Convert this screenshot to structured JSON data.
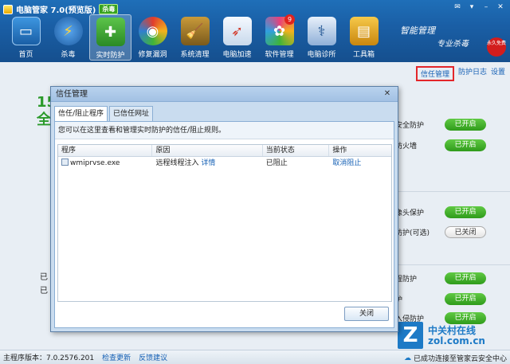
{
  "window": {
    "title": "电脑管家 7.0(预览版)",
    "badge": "杀毒",
    "controls": [
      "✉",
      "▾",
      "–",
      "✕"
    ]
  },
  "toolbar": {
    "items": [
      {
        "label": "首页",
        "icon": "monitor-icon",
        "color": "#2c7fd0"
      },
      {
        "label": "杀毒",
        "icon": "lightning-icon",
        "color": "#1d69b6"
      },
      {
        "label": "实时防护",
        "icon": "shield-icon",
        "color": "#2f9b2f",
        "active": true
      },
      {
        "label": "修复漏洞",
        "icon": "repair-icon",
        "color": "#e23c2c"
      },
      {
        "label": "系统清理",
        "icon": "broom-icon",
        "color": "#8a6b2a"
      },
      {
        "label": "电脑加速",
        "icon": "rocket-icon",
        "color": "#d9e6f5"
      },
      {
        "label": "软件管理",
        "icon": "apps-icon",
        "color": "#e8407a",
        "count": "9"
      },
      {
        "label": "电脑诊所",
        "icon": "stethoscope-icon",
        "color": "#5e8bc4"
      },
      {
        "label": "工具箱",
        "icon": "toolbox-icon",
        "color": "#e8a72a"
      }
    ],
    "slogan_1": "智能管理",
    "slogan_2": "专业杀毒",
    "stamp": "永久免费"
  },
  "links": {
    "trust": "信任管理",
    "log": "防护日志",
    "settings": "设置"
  },
  "background": {
    "big_text_1": "15",
    "big_text_2": "全",
    "left_text_1": "已",
    "left_text_2": "已",
    "rows": [
      {
        "label": "安全防护",
        "state": "已开启",
        "on": true
      },
      {
        "label": "防火墙",
        "state": "已开启",
        "on": true
      },
      {
        "label": "像头保护",
        "state": "已开启",
        "on": true
      },
      {
        "label": "防护(可选)",
        "state": "已关闭",
        "on": false
      },
      {
        "label": "程防护",
        "state": "已开启",
        "on": true
      },
      {
        "label": "护",
        "state": "已开启",
        "on": true
      },
      {
        "label": "入侵防护",
        "state": "已开启",
        "on": true
      }
    ]
  },
  "dialog": {
    "title": "信任管理",
    "close": "✕",
    "tabs": [
      "信任/阻止程序",
      "已信任网址"
    ],
    "description": "您可以在这里查看和管理实时防护的信任/阻止规则。",
    "columns": [
      "程序",
      "原因",
      "当前状态",
      "操作"
    ],
    "rows": [
      {
        "program": "wmiprvse.exe",
        "reason": "远程线程注入",
        "detail": "详情",
        "status": "已阻止",
        "action": "取消阻止"
      }
    ],
    "close_button": "关闭"
  },
  "statusbar": {
    "version": "主程序版本：7.0.2576.201",
    "check_update": "检查更新",
    "feedback": "反馈建议",
    "cloud": "已成功连接至管家云安全中心"
  },
  "watermark": {
    "cn": "中关村在线",
    "en": "zol.com.cn",
    "logo": "Z"
  }
}
